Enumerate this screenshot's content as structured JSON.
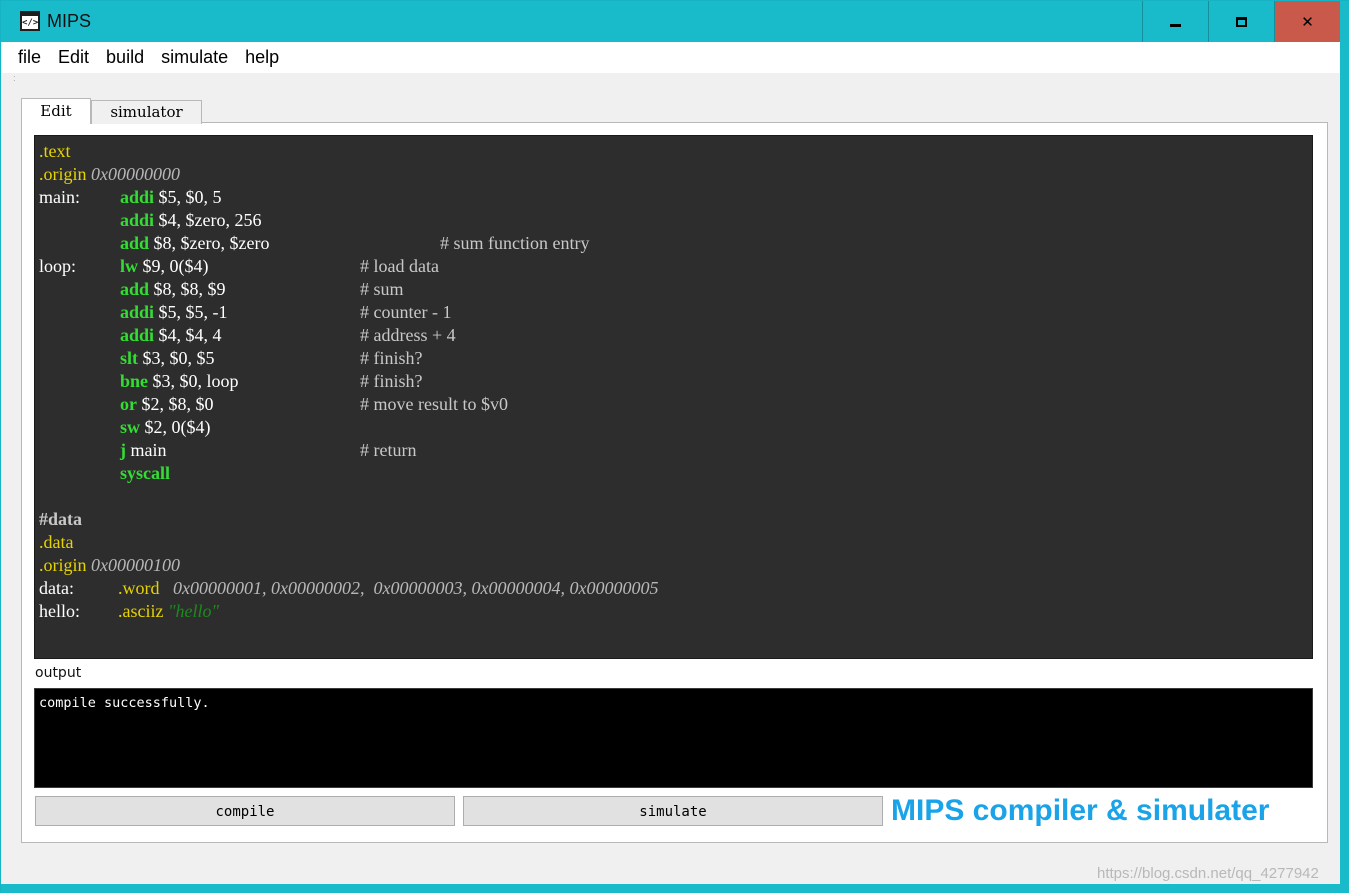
{
  "window": {
    "title": "MIPS",
    "icon": "code-window-icon",
    "icon_glyph": "</>"
  },
  "menu": [
    "file",
    "Edit",
    "build",
    "simulate",
    "help"
  ],
  "tabs": [
    {
      "label": "Edit",
      "active": true
    },
    {
      "label": "simulator",
      "active": false
    }
  ],
  "code": {
    "lines": [
      {
        "parts": [
          {
            "c": "dir",
            "t": ".text"
          }
        ]
      },
      {
        "parts": [
          {
            "c": "dir",
            "t": ".origin "
          },
          {
            "c": "hex",
            "t": "0x00000000"
          }
        ]
      },
      {
        "label": "main:",
        "parts": [
          {
            "c": "op",
            "t": "addi"
          },
          {
            "c": "args",
            "t": " $5, $0, 5"
          }
        ]
      },
      {
        "parts": [
          {
            "c": "op",
            "t": "addi"
          },
          {
            "c": "args",
            "t": " $4, $zero, 256"
          }
        ]
      },
      {
        "parts": [
          {
            "c": "op",
            "t": "add"
          },
          {
            "c": "args",
            "t": " $8, $zero, $zero"
          }
        ],
        "comment": "# sum function entry",
        "comment_col": "wide"
      },
      {
        "label": "loop:",
        "parts": [
          {
            "c": "op",
            "t": "lw"
          },
          {
            "c": "args",
            "t": " $9, 0($4)"
          }
        ],
        "comment": "# load data"
      },
      {
        "parts": [
          {
            "c": "op",
            "t": "add"
          },
          {
            "c": "args",
            "t": " $8, $8, $9"
          }
        ],
        "comment": "# sum"
      },
      {
        "parts": [
          {
            "c": "op",
            "t": "addi"
          },
          {
            "c": "args",
            "t": " $5, $5, -1"
          }
        ],
        "comment": "# counter - 1"
      },
      {
        "parts": [
          {
            "c": "op",
            "t": "addi"
          },
          {
            "c": "args",
            "t": " $4, $4, 4"
          }
        ],
        "comment": "# address + 4"
      },
      {
        "parts": [
          {
            "c": "op",
            "t": "slt"
          },
          {
            "c": "args",
            "t": " $3, $0, $5"
          }
        ],
        "comment": "# finish?"
      },
      {
        "parts": [
          {
            "c": "op",
            "t": "bne"
          },
          {
            "c": "args",
            "t": " $3, $0, loop"
          }
        ],
        "comment": "# finish?"
      },
      {
        "parts": [
          {
            "c": "op",
            "t": "or"
          },
          {
            "c": "args",
            "t": " $2, $8, $0"
          }
        ],
        "comment": "# move result to $v0"
      },
      {
        "parts": [
          {
            "c": "op",
            "t": "sw"
          },
          {
            "c": "args",
            "t": " $2, 0($4)"
          }
        ]
      },
      {
        "parts": [
          {
            "c": "op",
            "t": "j"
          },
          {
            "c": "args",
            "t": " main"
          }
        ],
        "comment": "# return"
      },
      {
        "parts": [
          {
            "c": "op",
            "t": "syscall"
          }
        ]
      },
      {
        "parts": []
      },
      {
        "parts": [
          {
            "c": "sect",
            "t": "#data"
          }
        ]
      },
      {
        "parts": [
          {
            "c": "dir",
            "t": ".data"
          }
        ]
      },
      {
        "parts": [
          {
            "c": "dir",
            "t": ".origin "
          },
          {
            "c": "hex",
            "t": "0x00000100"
          }
        ]
      },
      {
        "label": "data:",
        "parts": [
          {
            "c": "dir",
            "t": ".word   "
          },
          {
            "c": "hex",
            "t": "0x00000001, 0x00000002,  0x00000003, 0x00000004, 0x00000005"
          }
        ]
      },
      {
        "label": "hello:",
        "parts": [
          {
            "c": "dir",
            "t": ".asciiz "
          },
          {
            "c": "str",
            "t": "\"hello\""
          }
        ]
      }
    ]
  },
  "output": {
    "label": "output",
    "text": "compile successfully."
  },
  "buttons": {
    "compile": "compile",
    "simulate": "simulate"
  },
  "banner": "MIPS compiler & simulater",
  "watermark": "https://blog.csdn.net/qq_4277942",
  "colors": {
    "titlebar": "#19bac9",
    "close": "#c9594b",
    "editor_bg": "#2d2d2d",
    "opcode": "#33dd33",
    "directive": "#e6d300",
    "banner": "#1aa3e8"
  }
}
